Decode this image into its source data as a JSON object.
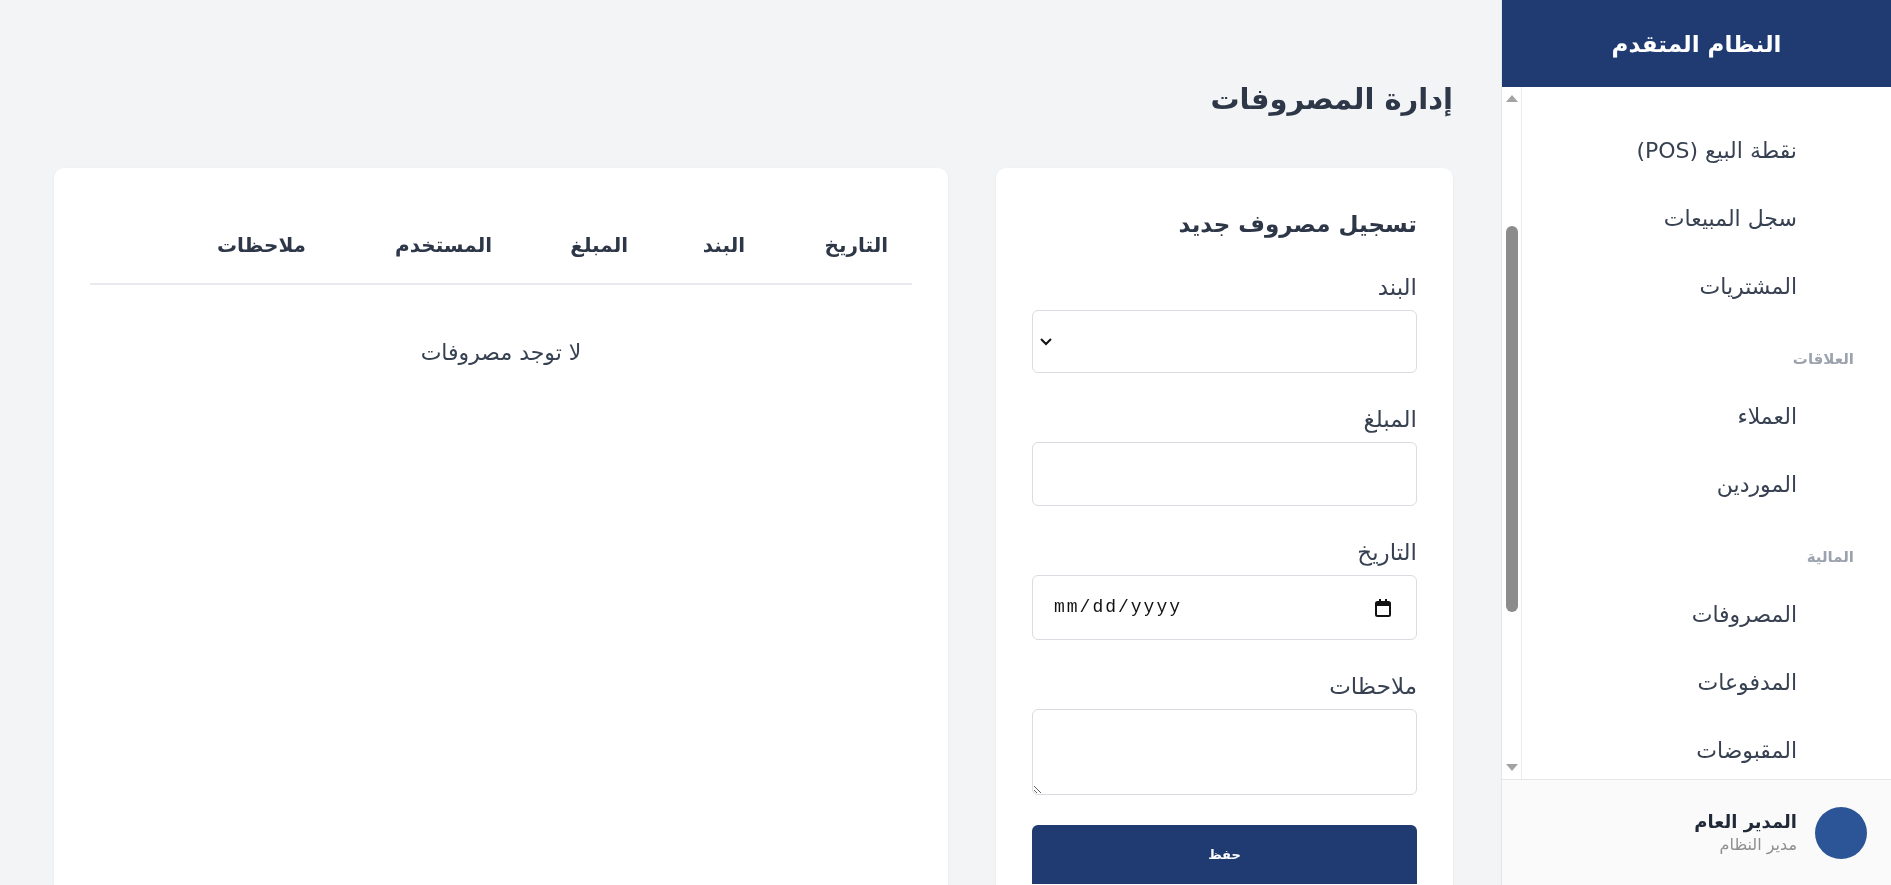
{
  "sidebar": {
    "title": "النظام المتقدم",
    "nav": [
      {
        "kind": "link",
        "label": "نقطة البيع (POS)"
      },
      {
        "kind": "link",
        "label": "سجل المبيعات"
      },
      {
        "kind": "link",
        "label": "المشتريات"
      },
      {
        "kind": "section",
        "label": "العلاقات"
      },
      {
        "kind": "link",
        "label": "العملاء"
      },
      {
        "kind": "link",
        "label": "الموردين"
      },
      {
        "kind": "section",
        "label": "المالية"
      },
      {
        "kind": "link",
        "label": "المصروفات"
      },
      {
        "kind": "link",
        "label": "المدفوعات"
      },
      {
        "kind": "link",
        "label": "المقبوضات"
      }
    ],
    "user": {
      "name": "المدير العام",
      "role": "مدير النظام"
    }
  },
  "page": {
    "title": "إدارة المصروفات"
  },
  "form": {
    "title": "تسجيل مصروف جديد",
    "fields": [
      {
        "kind": "select",
        "label": "البند"
      },
      {
        "kind": "text",
        "label": "المبلغ"
      },
      {
        "kind": "date",
        "label": "التاريخ",
        "placeholder": "mm/dd/yyyy"
      },
      {
        "kind": "textarea",
        "label": "ملاحظات"
      }
    ],
    "submit": "حفظ"
  },
  "table": {
    "columns": [
      "التاريخ",
      "البند",
      "المبلغ",
      "المستخدم",
      "ملاحظات"
    ],
    "empty_message": "لا توجد مصروفات"
  }
}
